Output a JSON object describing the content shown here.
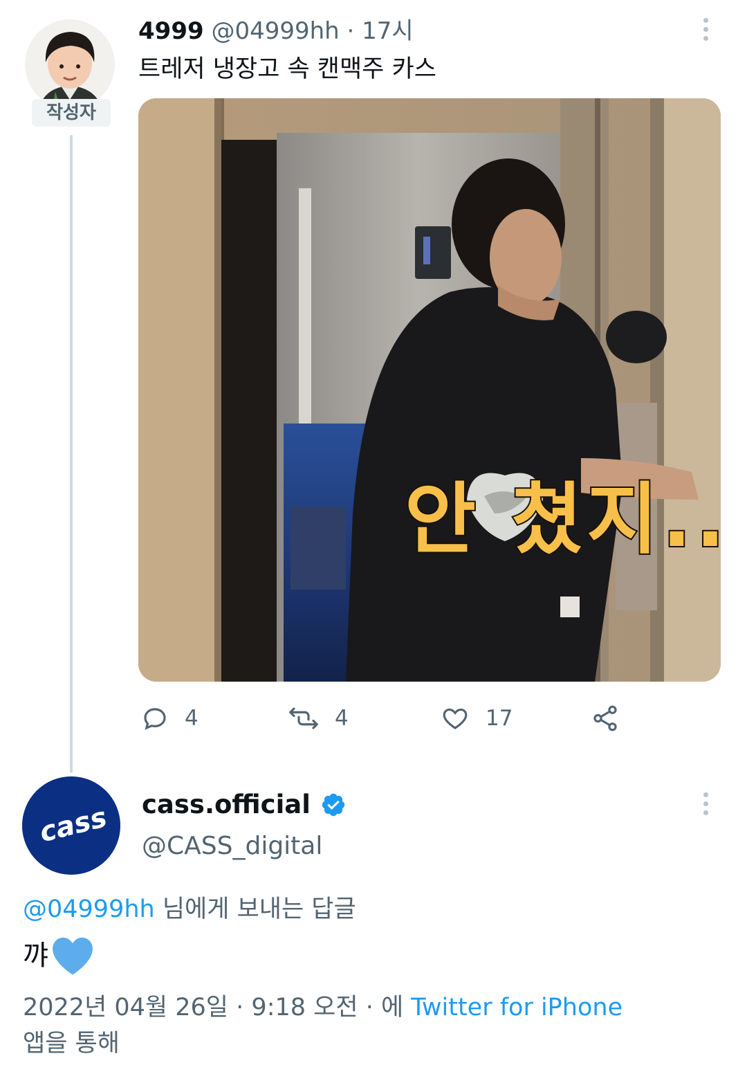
{
  "tweet1": {
    "author_badge": "작성자",
    "name": "4999",
    "handle": "@04999hh",
    "separator": "·",
    "time": "17시",
    "text": "트레저 냉장고 속 캔맥주 카스",
    "media_caption": "안 쳤지...",
    "actions": {
      "reply_count": "4",
      "retweet_count": "4",
      "like_count": "17"
    }
  },
  "tweet2": {
    "avatar_logo": "cass",
    "name": "cass.official",
    "handle": "@CASS_digital",
    "reply_to_mention": "@04999hh",
    "reply_to_suffix": " 님에게 보내는 답글",
    "text": "꺄",
    "emoji": "blue-heart",
    "meta": {
      "date": "2022년 04월 26일",
      "separator": "·",
      "time": "9:18 오전",
      "via_prefix": "· 에",
      "source": "Twitter for iPhone",
      "via_suffix": "앱을 통해"
    }
  },
  "colors": {
    "accent_blue": "#1d9bf0",
    "secondary_text": "#536471",
    "cass_navy": "#0b2f83",
    "caption_yellow": "#f8c04a"
  }
}
